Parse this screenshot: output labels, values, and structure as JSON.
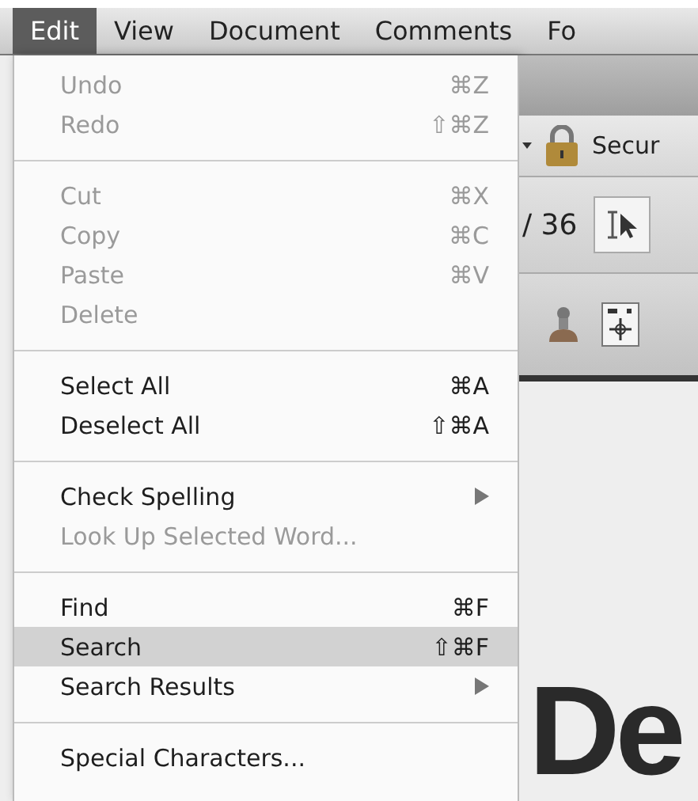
{
  "menu_bar": [
    {
      "label": "Edit",
      "selected": true
    },
    {
      "label": "View",
      "selected": false
    },
    {
      "label": "Document",
      "selected": false
    },
    {
      "label": "Comments",
      "selected": false
    },
    {
      "label": "Fo",
      "selected": false
    }
  ],
  "edit_menu": [
    {
      "kind": "item",
      "label": "Undo",
      "shortcut": "⌘Z",
      "disabled": true,
      "selected": false
    },
    {
      "kind": "item",
      "label": "Redo",
      "shortcut": "⇧⌘Z",
      "disabled": true,
      "selected": false
    },
    {
      "kind": "separator"
    },
    {
      "kind": "item",
      "label": "Cut",
      "shortcut": "⌘X",
      "disabled": true,
      "selected": false
    },
    {
      "kind": "item",
      "label": "Copy",
      "shortcut": "⌘C",
      "disabled": true,
      "selected": false
    },
    {
      "kind": "item",
      "label": "Paste",
      "shortcut": "⌘V",
      "disabled": true,
      "selected": false
    },
    {
      "kind": "item",
      "label": "Delete",
      "disabled": true,
      "selected": false
    },
    {
      "kind": "separator"
    },
    {
      "kind": "item",
      "label": "Select All",
      "shortcut": "⌘A",
      "disabled": false,
      "selected": false
    },
    {
      "kind": "item",
      "label": "Deselect All",
      "shortcut": "⇧⌘A",
      "disabled": false,
      "selected": false
    },
    {
      "kind": "separator"
    },
    {
      "kind": "submenu",
      "label": "Check Spelling",
      "disabled": false,
      "selected": false
    },
    {
      "kind": "item",
      "label": "Look Up Selected Word...",
      "disabled": true,
      "selected": false
    },
    {
      "kind": "separator"
    },
    {
      "kind": "item",
      "label": "Find",
      "shortcut": "⌘F",
      "disabled": false,
      "selected": false
    },
    {
      "kind": "item",
      "label": "Search",
      "shortcut": "⇧⌘F",
      "disabled": false,
      "selected": true
    },
    {
      "kind": "submenu",
      "label": "Search Results",
      "disabled": false,
      "selected": false
    },
    {
      "kind": "separator"
    },
    {
      "kind": "item",
      "label": "Special Characters...",
      "disabled": false,
      "selected": false
    }
  ],
  "toolbar": {
    "security_label": "Secur",
    "page_total": "/ 36"
  },
  "document": {
    "heading": "De"
  }
}
